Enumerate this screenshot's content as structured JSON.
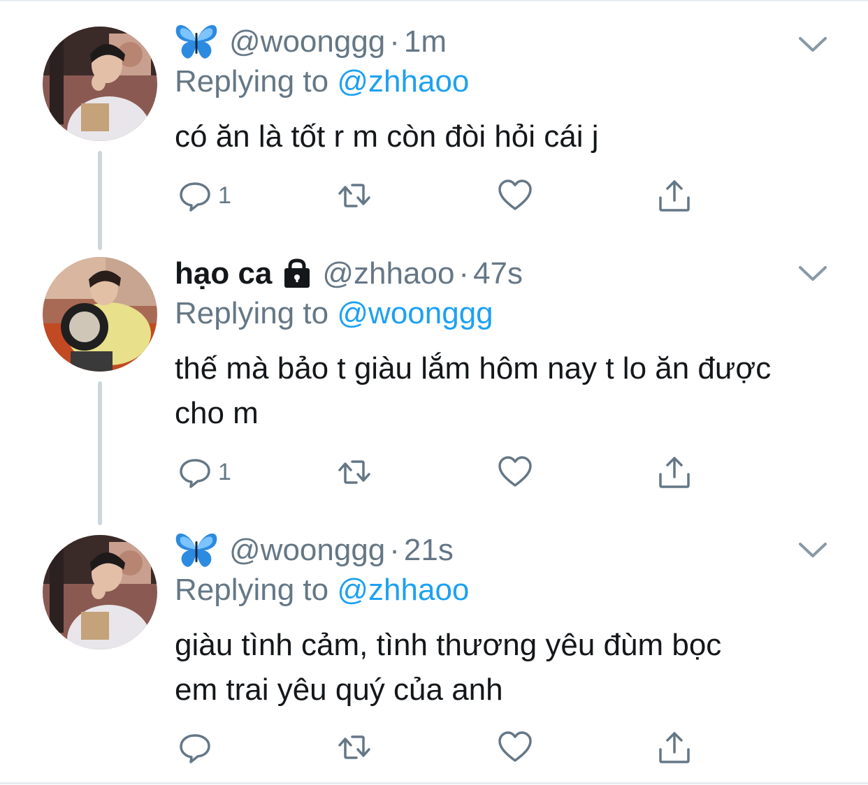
{
  "colors": {
    "text": "#14171a",
    "muted": "#657786",
    "accent": "#1da1f2",
    "thread_line": "#ccd6dd"
  },
  "tweets": [
    {
      "display_name": "",
      "username_icon": "blue-butterfly-icon",
      "handle": "@woonggg",
      "separator": "·",
      "time": "1m",
      "replying_prefix": "Replying to",
      "replying_to": "@zhhaoo",
      "text_lines": [
        "có ăn là tốt r m còn đòi hỏi cái j"
      ],
      "reply_count": "1",
      "avatar": "avatar-woonggg"
    },
    {
      "display_name": "hạo ca",
      "username_icon": "lock-icon",
      "handle": "@zhhaoo",
      "separator": "·",
      "time": "47s",
      "replying_prefix": "Replying to",
      "replying_to": "@woonggg",
      "text_lines": [
        "thế mà bảo t giàu lắm hôm nay t lo ăn được",
        "cho m"
      ],
      "reply_count": "1",
      "avatar": "avatar-zhhaoo"
    },
    {
      "display_name": "",
      "username_icon": "blue-butterfly-icon",
      "handle": "@woonggg",
      "separator": "·",
      "time": "21s",
      "replying_prefix": "Replying to",
      "replying_to": "@zhhaoo",
      "text_lines": [
        "giàu tình cảm, tình thương yêu đùm bọc",
        "em trai yêu quý của anh"
      ],
      "reply_count": "",
      "avatar": "avatar-woonggg"
    }
  ]
}
